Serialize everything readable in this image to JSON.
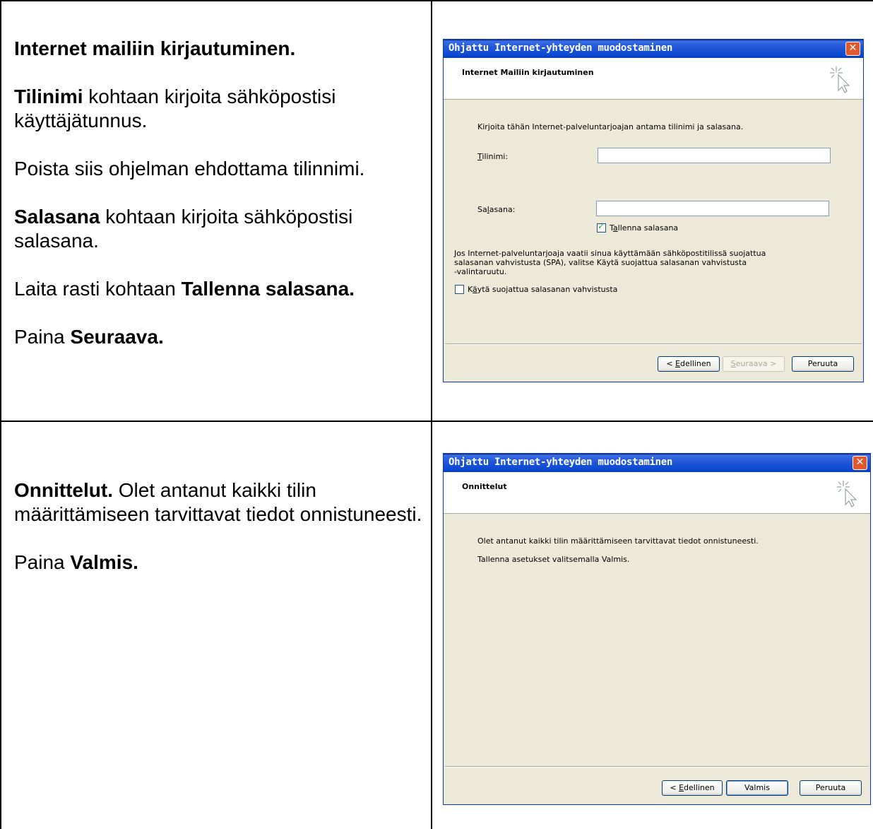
{
  "row1": {
    "instructions": {
      "heading": "Internet mailiin kirjautuminen.",
      "p1_bold": "Tilinimi",
      "p1_rest": " kohtaan kirjoita sähköpostisi käyttäjätunnus.",
      "p2": "Poista siis ohjelman ehdottama tilinnimi.",
      "p3_bold": "Salasana",
      "p3_rest": " kohtaan kirjoita sähköpostisi salasana.",
      "p4_pre": "Laita rasti kohtaan ",
      "p4_bold": "Tallenna salasana.",
      "p5_pre": "Paina ",
      "p5_bold": "Seuraava."
    },
    "dialog": {
      "title": "Ohjattu Internet-yhteyden muodostaminen",
      "close_glyph": "✕",
      "header_title": "Internet Mailiin kirjautuminen",
      "intro": "Kirjoita tähän Internet-palveluntarjoajan antama tilinimi ja salasana.",
      "account_label_u": "T",
      "account_label_rest": "ilinimi:",
      "account_value": "",
      "password_label_pre": "Sa",
      "password_label_u": "l",
      "password_label_rest": "asana:",
      "password_value": "",
      "save_password_checked": true,
      "save_password_check_glyph": "✓",
      "save_password_pre": "T",
      "save_password_u": "a",
      "save_password_rest": "llenna salasana",
      "spa_info_line1": "Jos Internet-palveluntarjoaja vaatii sinua käyttämään sähköpostitilissä suojattua",
      "spa_info_line2": "salasanan vahvistusta (SPA), valitse Käytä suojattua salasanan vahvistusta",
      "spa_info_line3": "-valintaruutu.",
      "spa_checked": false,
      "spa_pre": "K",
      "spa_u": "ä",
      "spa_rest": "ytä suojattua salasanan vahvistusta",
      "back_pre": "< ",
      "back_u": "E",
      "back_rest": "dellinen",
      "next_u": "S",
      "next_rest": "euraava >",
      "cancel_label": "Peruuta"
    }
  },
  "row2": {
    "instructions": {
      "p1_bold": "Onnittelut.",
      "p1_rest": " Olet antanut kaikki tilin määrittämiseen tarvittavat tiedot onnistuneesti.",
      "p2_pre": "Paina ",
      "p2_bold": "Valmis."
    },
    "dialog": {
      "title": "Ohjattu Internet-yhteyden muodostaminen",
      "close_glyph": "✕",
      "header_title": "Onnittelut",
      "line1": "Olet antanut kaikki tilin määrittämiseen tarvittavat tiedot onnistuneesti.",
      "line2": "Tallenna asetukset valitsemalla Valmis.",
      "back_pre": "< ",
      "back_u": "E",
      "back_rest": "dellinen",
      "finish_label": "Valmis",
      "cancel_label": "Peruuta"
    }
  }
}
